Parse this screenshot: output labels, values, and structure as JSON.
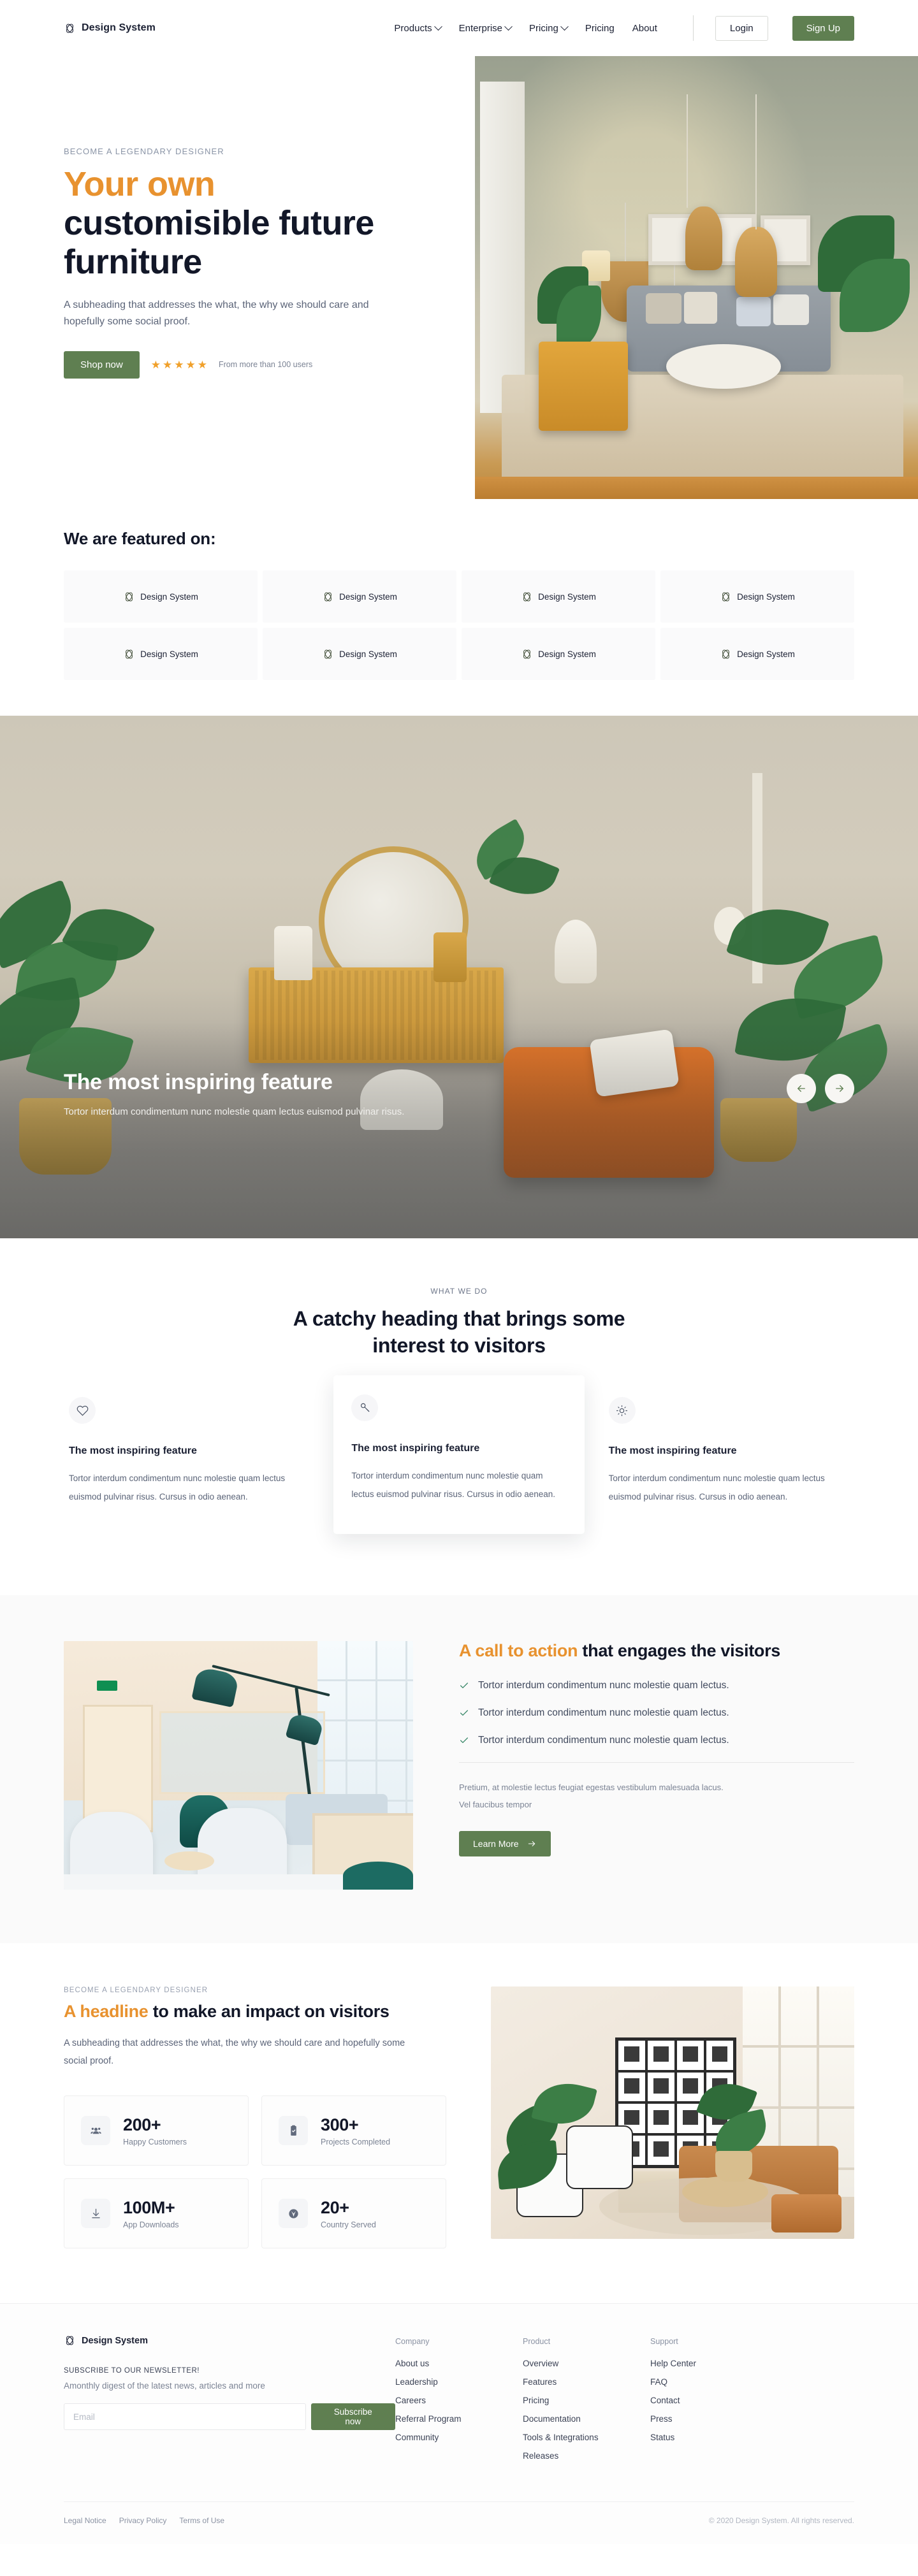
{
  "brand": {
    "name": "Design System",
    "logo_icon": "infinity-knot-logo"
  },
  "nav": {
    "links": [
      {
        "label": "Products",
        "has_dropdown": true
      },
      {
        "label": "Enterprise",
        "has_dropdown": true
      },
      {
        "label": "Pricing",
        "has_dropdown": true
      },
      {
        "label": "Pricing",
        "has_dropdown": false
      },
      {
        "label": "About",
        "has_dropdown": false
      }
    ],
    "login_label": "Login",
    "signup_label": "Sign Up"
  },
  "hero": {
    "eyebrow": "BECOME A LEGENDARY DESIGNER",
    "title_accent": "Your own",
    "title_rest": "customisible future furniture",
    "subheading": "A subheading that addresses the what, the why we should care and hopefully some social proof.",
    "cta_label": "Shop now",
    "stars": 5,
    "rating_text": "From more than 100 users"
  },
  "featured": {
    "heading": "We are featured on:",
    "logos": [
      "Design System",
      "Design System",
      "Design System",
      "Design System",
      "Design System",
      "Design System",
      "Design System",
      "Design System"
    ]
  },
  "carousel": {
    "title": "The most inspiring feature",
    "subtitle": "Tortor interdum condimentum nunc molestie quam lectus euismod pulvinar risus.",
    "prev_icon": "arrow-left-icon",
    "next_icon": "arrow-right-icon"
  },
  "whatwedo": {
    "eyebrow": "WHAT WE DO",
    "heading": "A catchy heading that brings some interest to visitors",
    "cards": [
      {
        "icon": "heart-icon",
        "title": "The most inspiring feature",
        "body": "Tortor interdum condimentum nunc molestie quam lectus euismod pulvinar risus. Cursus in odio aenean."
      },
      {
        "icon": "key-icon",
        "title": "The most inspiring feature",
        "body": "Tortor interdum condimentum nunc molestie quam lectus euismod pulvinar risus. Cursus in odio aenean."
      },
      {
        "icon": "sun-icon",
        "title": "The most inspiring feature",
        "body": "Tortor interdum condimentum nunc molestie quam lectus euismod pulvinar risus. Cursus in odio aenean."
      }
    ]
  },
  "cta": {
    "heading_accent": "A call to action",
    "heading_rest": " that engages the visitors",
    "items": [
      "Tortor interdum condimentum nunc molestie quam lectus.",
      "Tortor interdum condimentum nunc molestie quam lectus.",
      "Tortor interdum condimentum nunc molestie quam lectus."
    ],
    "paragraph": "Pretium, at molestie lectus feugiat egestas vestibulum malesuada lacus. Vel faucibus tempor",
    "button_label": "Learn More",
    "button_icon": "arrow-right-icon",
    "check_icon": "check-icon",
    "image_alt": "office-lounge-photo"
  },
  "stats": {
    "eyebrow": "BECOME A LEGENDARY DESIGNER",
    "heading_accent": "A headline",
    "heading_rest": " to make an impact on visitors",
    "subheading": "A subheading that addresses the what, the why we should care and hopefully some social proof.",
    "cards": [
      {
        "icon": "people-icon",
        "value": "200+",
        "label": "Happy Customers"
      },
      {
        "icon": "clipboard-icon",
        "value": "300+",
        "label": "Projects Completed"
      },
      {
        "icon": "download-icon",
        "value": "100M+",
        "label": "App Downloads"
      },
      {
        "icon": "globe-icon",
        "value": "20+",
        "label": "Country Served"
      }
    ],
    "image_alt": "modern-living-room-photo"
  },
  "footer": {
    "brand": "Design System",
    "newsletter_title": "SUBSCRIBE TO OUR NEWSLETTER!",
    "newsletter_sub": "Amonthly digest of the latest news, articles and more",
    "email_placeholder": "Email",
    "email_value": "",
    "subscribe_label": "Subscribe now",
    "columns": [
      {
        "title": "Company",
        "links": [
          "About us",
          "Leadership",
          "Careers",
          "Referral Program",
          "Community"
        ]
      },
      {
        "title": "Product",
        "links": [
          "Overview",
          "Features",
          "Pricing",
          "Documentation",
          "Tools & Integrations",
          "Releases"
        ]
      },
      {
        "title": "Support",
        "links": [
          "Help Center",
          "FAQ",
          "Contact",
          "Press",
          "Status"
        ]
      }
    ],
    "legal": [
      "Legal Notice",
      "Privacy Policy",
      "Terms of Use"
    ],
    "copyright": "© 2020 Design System. All rights reserved."
  },
  "colors": {
    "accent_orange": "#e8922f",
    "brand_green": "#5f7f51",
    "ink": "#121728",
    "muted": "#7b8394",
    "star": "#f0a02a",
    "check_green": "#3c8a6b"
  }
}
